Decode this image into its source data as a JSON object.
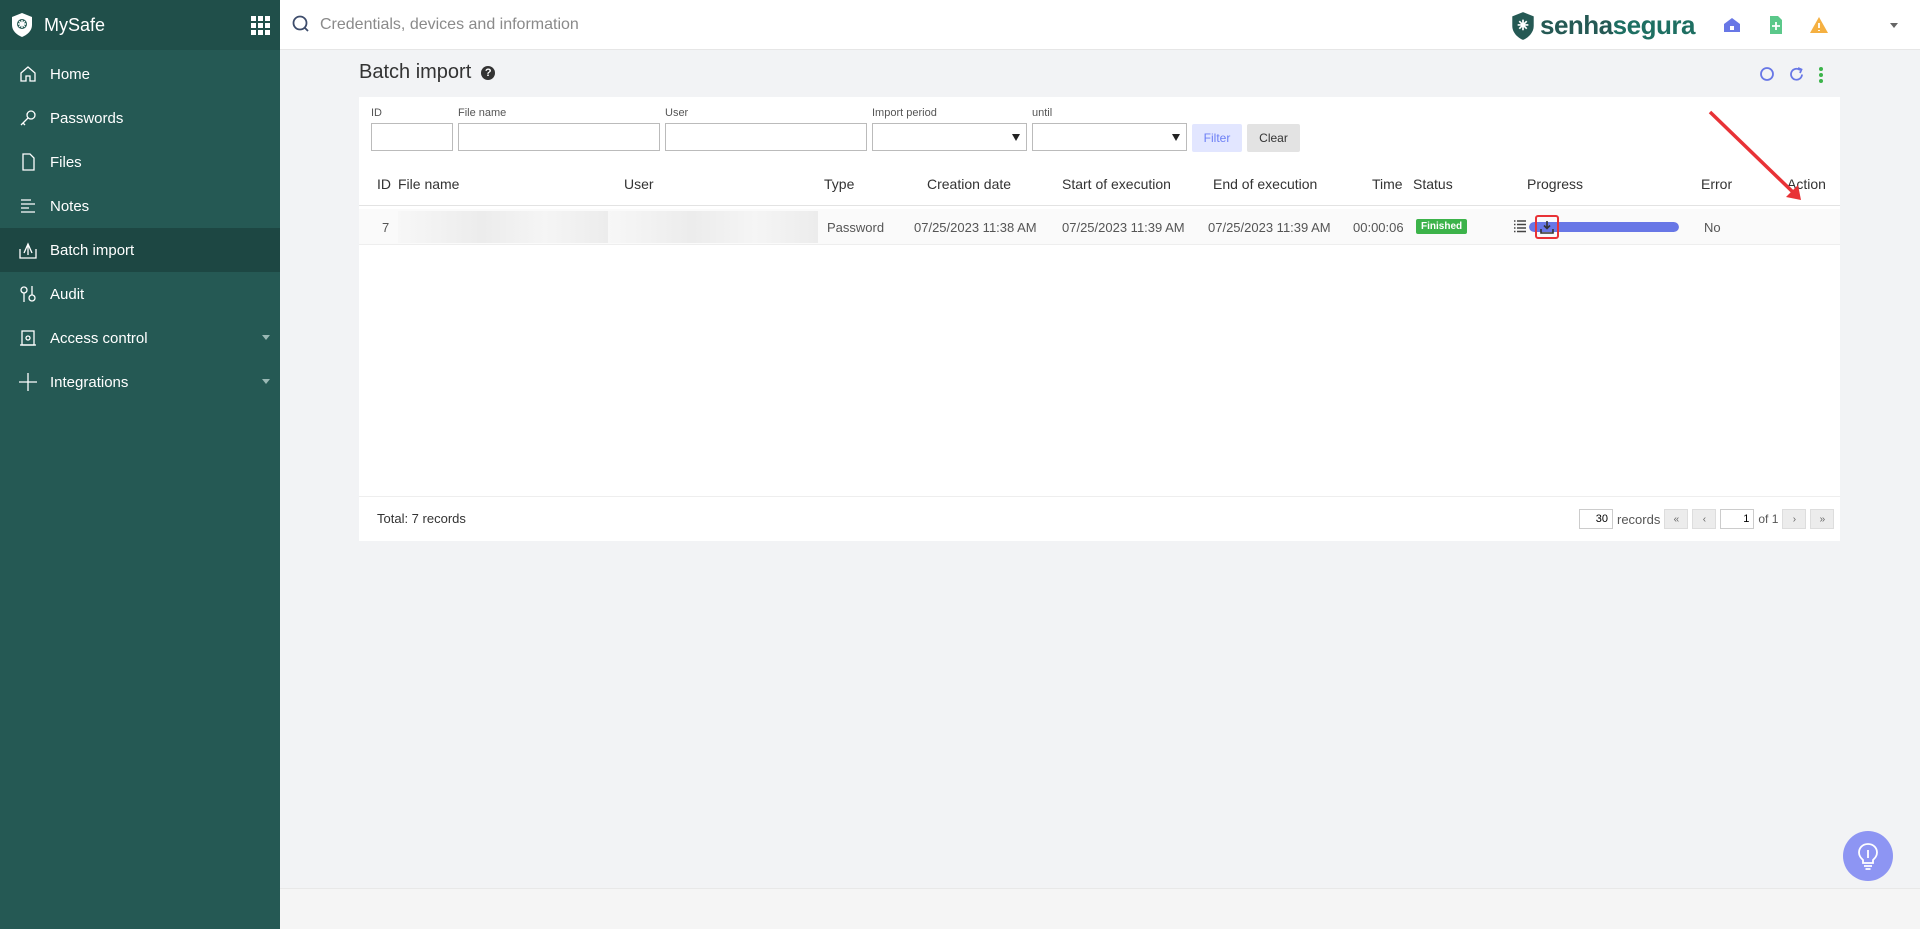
{
  "sidebar": {
    "app_name": "MySafe",
    "items": [
      {
        "label": "Home",
        "icon": "home-icon"
      },
      {
        "label": "Passwords",
        "icon": "key-icon"
      },
      {
        "label": "Files",
        "icon": "file-icon"
      },
      {
        "label": "Notes",
        "icon": "notes-icon"
      },
      {
        "label": "Batch import",
        "icon": "batch-import-icon",
        "active": true
      },
      {
        "label": "Audit",
        "icon": "audit-icon"
      },
      {
        "label": "Access control",
        "icon": "access-control-icon",
        "expandable": true
      },
      {
        "label": "Integrations",
        "icon": "plus-icon",
        "expandable": true
      }
    ]
  },
  "topbar": {
    "search_placeholder": "Credentials, devices and information",
    "brand_part1": "senha",
    "brand_part2": "segura"
  },
  "page": {
    "title": "Batch import"
  },
  "filters": {
    "id_label": "ID",
    "file_name_label": "File name",
    "user_label": "User",
    "import_period_label": "Import period",
    "until_label": "until",
    "filter_button": "Filter",
    "clear_button": "Clear"
  },
  "table": {
    "columns": [
      "ID",
      "File name",
      "User",
      "Type",
      "Creation date",
      "Start of execution",
      "End of execution",
      "Time",
      "Status",
      "Progress",
      "Error",
      "Action"
    ],
    "rows": [
      {
        "id": "7",
        "type": "Password",
        "creation_date": "07/25/2023 11:38 AM",
        "start_of_execution": "07/25/2023 11:39 AM",
        "end_of_execution": "07/25/2023 11:39 AM",
        "time": "00:00:06",
        "status": "Finished",
        "progress_percent": 100,
        "error": "No"
      }
    ]
  },
  "footer": {
    "total": "Total: 7 records",
    "page_size": "30",
    "records_label": "records",
    "current_page": "1",
    "of_label": "of 1"
  },
  "colors": {
    "sidebar": "#255954",
    "accent": "#6877e6",
    "status_finished": "#3cb34a",
    "highlight": "#e83236"
  }
}
